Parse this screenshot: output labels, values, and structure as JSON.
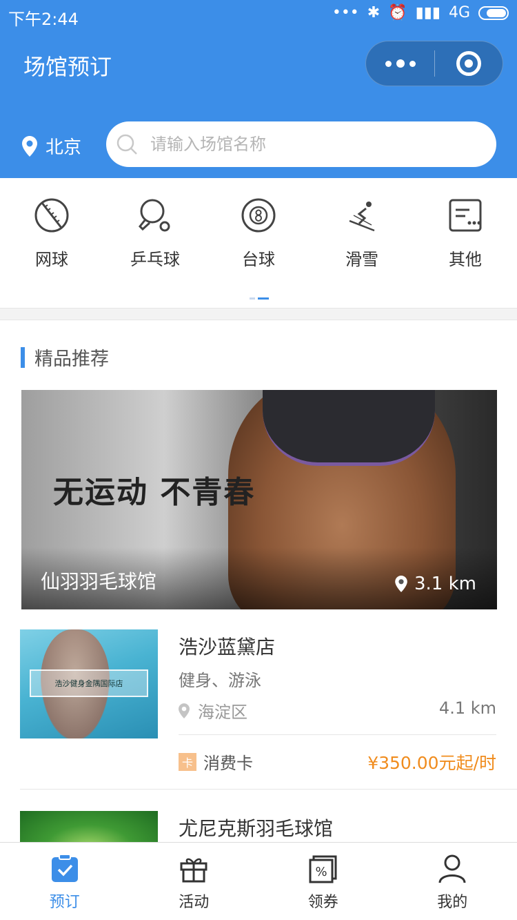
{
  "status": {
    "time": "下午2:44",
    "network": "4G"
  },
  "navbar": {
    "title": "场馆预订"
  },
  "location": {
    "city": "北京"
  },
  "search": {
    "placeholder": "请输入场馆名称"
  },
  "categories": [
    {
      "label": "网球",
      "icon": "tennis-icon"
    },
    {
      "label": "乒乓球",
      "icon": "ping-pong-icon"
    },
    {
      "label": "台球",
      "icon": "billiards-icon"
    },
    {
      "label": "滑雪",
      "icon": "ski-icon"
    },
    {
      "label": "其他",
      "icon": "other-icon"
    }
  ],
  "featured": {
    "title": "精品推荐",
    "banner": {
      "slogan": "无运动 不青春",
      "venue": "仙羽羽毛球馆",
      "distance": "3.1 km"
    }
  },
  "venues": [
    {
      "name": "浩沙蓝黛店",
      "tags": "健身、游泳",
      "district": "海淀区",
      "distance": "4.1 km",
      "card_badge": "卡",
      "card_label": "消费卡",
      "price": "¥350.00元起/时",
      "thumb_text": "浩沙健身金隅国际店"
    },
    {
      "name": "尤尼克斯羽毛球馆"
    }
  ],
  "tabbar": [
    {
      "label": "预订",
      "active": true
    },
    {
      "label": "活动"
    },
    {
      "label": "领券"
    },
    {
      "label": "我的"
    }
  ],
  "colors": {
    "primary": "#3c8ee8",
    "price": "#f08c1e"
  }
}
